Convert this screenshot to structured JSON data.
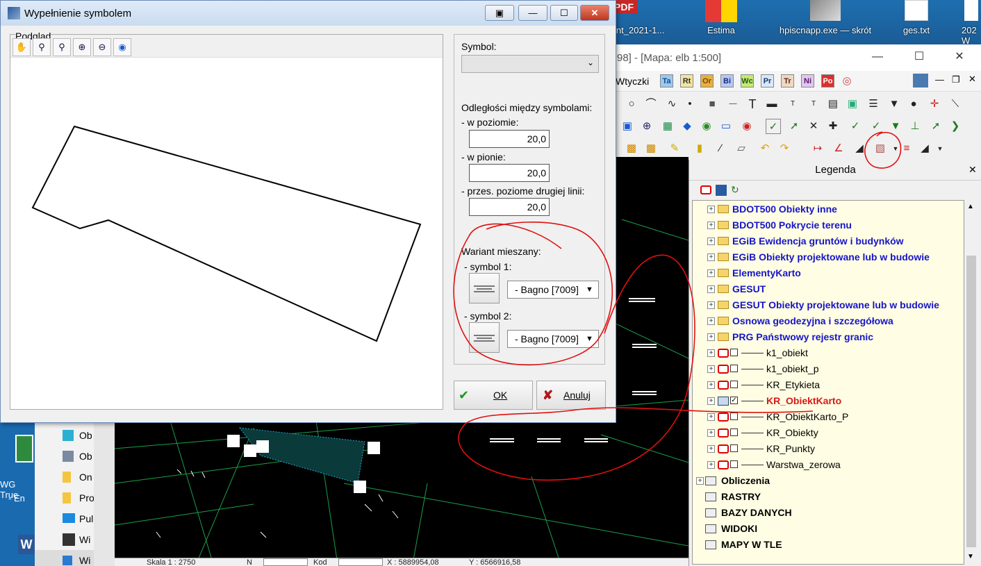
{
  "desktop": {
    "icons": [
      {
        "label": "ant_2021-1...",
        "icon": "pdf-file-icon"
      },
      {
        "label": "Estima",
        "icon": "estima-app-icon"
      },
      {
        "label": "hpiscnapp.exe — skrót",
        "icon": "scanner-app-icon"
      },
      {
        "label": "ges.txt",
        "icon": "text-file-icon"
      },
      {
        "label": "202 W",
        "icon": "file-icon"
      }
    ],
    "pdf_badge": "PDF",
    "left_text": [
      "WG True",
      "- En"
    ]
  },
  "app": {
    "title": "98] - [Mapa: elb  1:500]",
    "menu_item": "Wtyczki",
    "tags": [
      "Ta",
      "Rt",
      "Or",
      "Bi",
      "Wc",
      "Pr",
      "Tr",
      "Ni",
      "Po"
    ],
    "status": [
      "Skala 1 : 2750",
      "N",
      "Kod",
      "X : 5889954,08",
      "Y : 6566916,58"
    ]
  },
  "legend": {
    "title": "Legenda",
    "items": [
      {
        "label": "BDOT500 Obiekty inne",
        "type": "folder"
      },
      {
        "label": "BDOT500 Pokrycie terenu",
        "type": "folder"
      },
      {
        "label": "EGiB Ewidencja gruntów i budynków",
        "type": "folder"
      },
      {
        "label": "EGiB Obiekty projektowane lub w budowie",
        "type": "folder"
      },
      {
        "label": "ElementyKarto",
        "type": "folder"
      },
      {
        "label": "GESUT",
        "type": "folder"
      },
      {
        "label": "GESUT Obiekty projektowane lub w budowie",
        "type": "folder"
      },
      {
        "label": "Osnowa geodezyjna i szczegółowa",
        "type": "folder"
      },
      {
        "label": "PRG Państwowy rejestr granic",
        "type": "folder"
      },
      {
        "label": "k1_obiekt",
        "type": "layer",
        "checked": false
      },
      {
        "label": "k1_obiekt_p",
        "type": "layer",
        "checked": false
      },
      {
        "label": "KR_Etykieta",
        "type": "layer",
        "checked": false
      },
      {
        "label": "KR_ObiektKarto",
        "type": "layer",
        "checked": true
      },
      {
        "label": "KR_ObiektKarto_P",
        "type": "layer",
        "checked": false
      },
      {
        "label": "KR_Obiekty",
        "type": "layer",
        "checked": false
      },
      {
        "label": "KR_Punkty",
        "type": "layer",
        "checked": false
      },
      {
        "label": "Warstwa_zerowa",
        "type": "layer",
        "checked": false
      }
    ],
    "groups": [
      "Obliczenia",
      "RASTRY",
      "BAZY DANYCH",
      "WIDOKI",
      "MAPY W TLE"
    ]
  },
  "dialog": {
    "title": "Wypełnienie symbolem",
    "preview_label": "Podgląd",
    "symbol_label": "Symbol:",
    "symbol_value": "",
    "spacing_label": "Odległości między symbolami:",
    "horizontal_label": "- w poziomie:",
    "horizontal_value": "20,0",
    "vertical_label": "- w pionie:",
    "vertical_value": "20,0",
    "offset_label": "- przes. poziome drugiej linii:",
    "offset_value": "20,0",
    "mixed_label": "Wariant mieszany:",
    "symbol1_label": "- symbol 1:",
    "symbol1_value": "- Bagno [7009]",
    "symbol2_label": "- symbol 2:",
    "symbol2_value": "- Bagno [7009]",
    "ok_label": "OK",
    "cancel_label": "Anuluj"
  },
  "taskbar_left": [
    "Ob",
    "Ob",
    "On",
    "Pro",
    "Pul",
    "Wi",
    "Wi"
  ]
}
